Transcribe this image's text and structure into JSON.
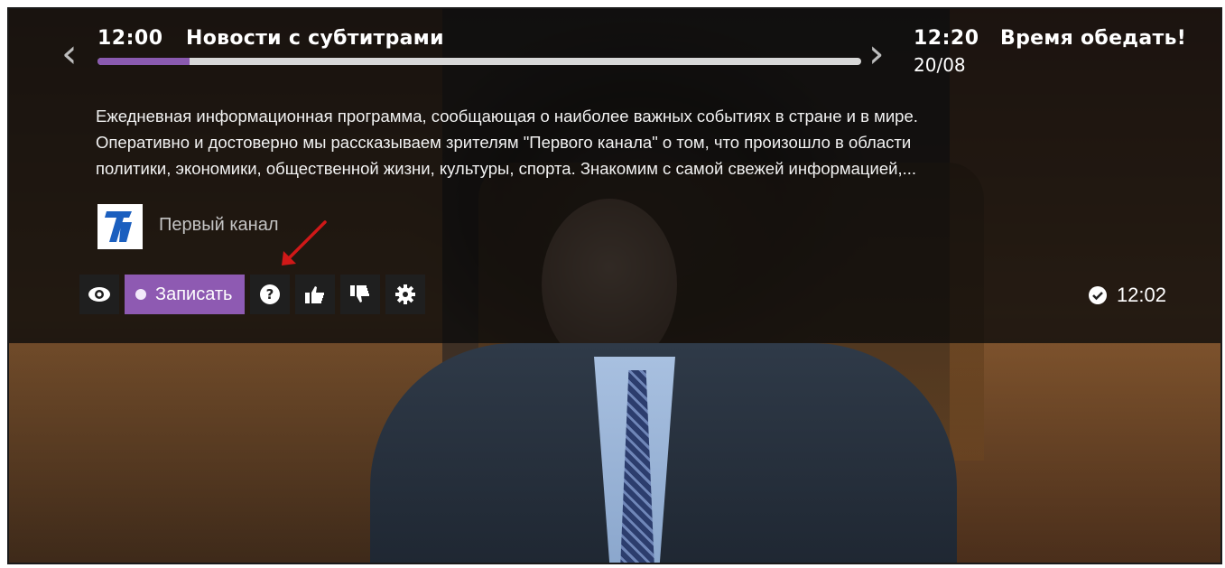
{
  "now": {
    "time": "12:00",
    "title": "Новости с субтитрами",
    "progress": 0.12
  },
  "next": {
    "time": "12:20",
    "date": "20/08",
    "title": "Время обедать!"
  },
  "description": [
    "Ежедневная информационная программа, сообщающая о наиболее важных событиях в стране и в мире.",
    "Оперативно и достоверно мы рассказываем зрителям \"Первого канала\" о том, что произошло в области",
    "политики, экономики, общественной жизни, культуры, спорта. Знакомим с самой свежей информацией,..."
  ],
  "channel": {
    "name": "Первый канал",
    "logo_icon": "first-channel-logo"
  },
  "toolbar": {
    "record_label": "Записать",
    "icons": [
      "eye-icon",
      "record-dot-icon",
      "help-icon",
      "thumbs-up-icon",
      "thumbs-down-icon",
      "gear-icon"
    ]
  },
  "clock": {
    "time": "12:02",
    "icon": "check-circle-icon"
  },
  "colors": {
    "accent": "#8e5ab2",
    "overlay": "#0a0a0a",
    "annotation_arrow": "#d01818"
  }
}
